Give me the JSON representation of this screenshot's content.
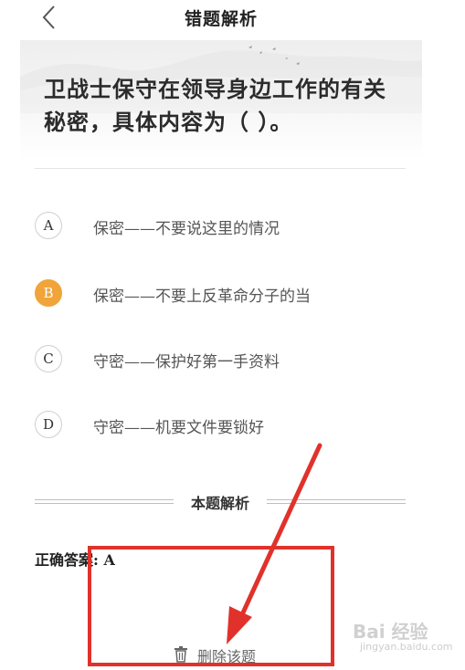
{
  "header": {
    "title": "错题解析",
    "back_icon": "chevron-left-icon"
  },
  "question": {
    "text": "卫战士保守在领导身边工作的有关秘密，具体内容为（  ）。"
  },
  "options": [
    {
      "letter": "A",
      "text": "保密——不要说这里的情况",
      "selected": false
    },
    {
      "letter": "B",
      "text": "保密——不要上反革命分子的当",
      "selected": true
    },
    {
      "letter": "C",
      "text": "守密——保护好第一手资料",
      "selected": false
    },
    {
      "letter": "D",
      "text": "守密——机要文件要锁好",
      "selected": false
    }
  ],
  "analysis": {
    "heading": "本题解析",
    "correct_answer": "正确答案: A"
  },
  "actions": {
    "delete_label": "删除该题",
    "delete_icon": "trash-icon"
  },
  "annotation": {
    "color": "#e0322b"
  },
  "watermark": {
    "text": "Bai 经验",
    "sub": "jingyan.baidu.com"
  },
  "colors": {
    "selected_option": "#f0a43a",
    "annotation": "#e0322b"
  }
}
